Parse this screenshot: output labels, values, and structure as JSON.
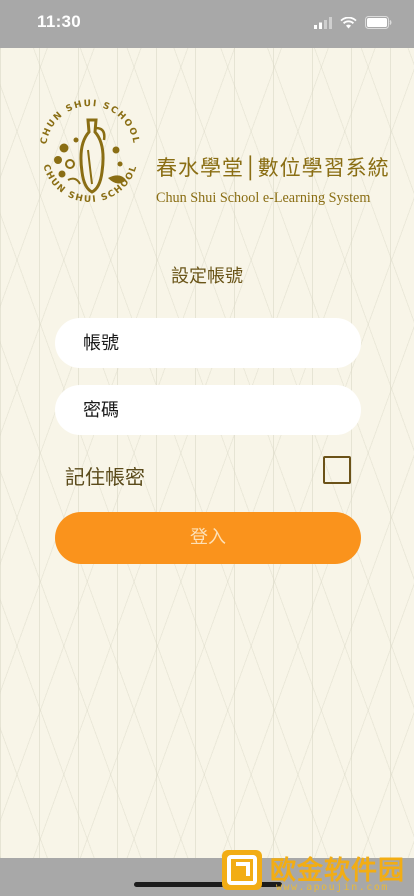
{
  "status_bar": {
    "time": "11:30",
    "icons": [
      "signal-icon",
      "wifi-icon",
      "battery-icon"
    ]
  },
  "logo": {
    "title": "春水學堂│數位學習系統",
    "subtitle": "Chun Shui School e-Learning System",
    "ring_text": "CHUN SHUI SCHOOL",
    "color": "#8a6e14"
  },
  "settings_link": "設定帳號",
  "form": {
    "account_placeholder": "帳號",
    "password_placeholder": "密碼",
    "remember_label": "記住帳密",
    "remember_checked": false,
    "login_label": "登入"
  },
  "colors": {
    "accent": "#fa931c",
    "brand": "#8a6e14",
    "background": "#f8f5e8"
  },
  "watermark": {
    "text": "欧金软件园",
    "url": "www.apoujin.com"
  }
}
